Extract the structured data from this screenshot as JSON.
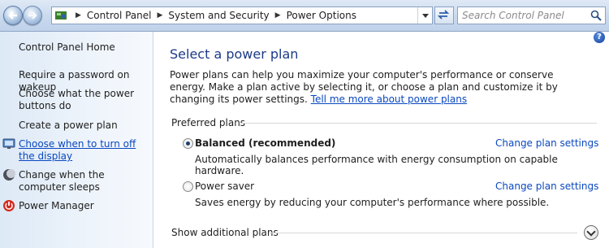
{
  "window": {
    "address": {
      "crumbs": [
        "Control Panel",
        "System and Security",
        "Power Options"
      ]
    },
    "search": {
      "placeholder": "Search Control Panel"
    }
  },
  "sidebar": {
    "items": [
      {
        "label": "Control Panel Home",
        "icon": ""
      },
      {
        "label": "Require a password on wakeup",
        "icon": ""
      },
      {
        "label": "Choose what the power buttons do",
        "icon": ""
      },
      {
        "label": "Create a power plan",
        "icon": ""
      },
      {
        "label": "Choose when to turn off the display",
        "icon": "monitor-icon",
        "hovered": true
      },
      {
        "label": "Change when the computer sleeps",
        "icon": "moon-icon"
      },
      {
        "label": "Power Manager",
        "icon": "power-manager-icon"
      }
    ]
  },
  "main": {
    "title": "Select a power plan",
    "description": "Power plans can help you maximize your computer's performance or conserve energy. Make a plan active by selecting it, or choose a plan and customize it by changing its power settings.",
    "link": "Tell me more about power plans",
    "section_title": "Preferred plans",
    "plans": [
      {
        "name": "Balanced (recommended)",
        "selected": true,
        "description": "Automatically balances performance with energy consumption on capable hardware.",
        "action": "Change plan settings"
      },
      {
        "name": "Power saver",
        "selected": false,
        "description": "Saves energy by reducing your computer's performance where possible.",
        "action": "Change plan settings"
      }
    ],
    "show_additional": "Show additional plans"
  },
  "colors": {
    "title": "#1c3a87",
    "link": "#0a48c0",
    "sidebar_bg": "#e4eef9"
  }
}
